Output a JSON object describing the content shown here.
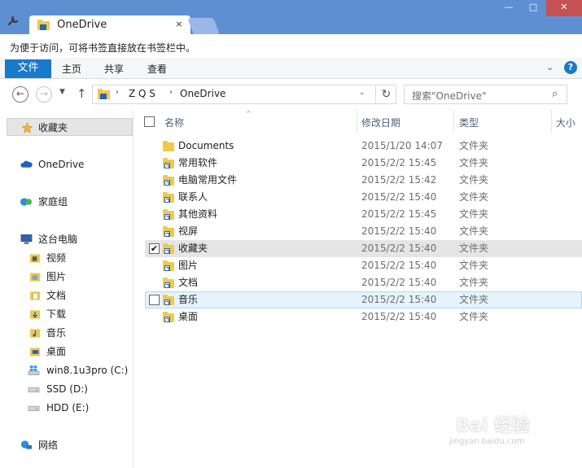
{
  "window": {
    "tab_title": "OneDrive",
    "tab_close": "×",
    "min": "—",
    "max": "□",
    "close": "✕"
  },
  "bookmark_hint": "为便于访问，可将书签直接放在书签栏中。",
  "ribbon": {
    "file": "文件",
    "tabs": [
      "主页",
      "共享",
      "查看"
    ],
    "expand": "⌄",
    "help": "?"
  },
  "nav": {
    "back": "←",
    "forward": "→",
    "recent": "▼",
    "up": "↑",
    "breadcrumb": [
      "Z Q S",
      "OneDrive"
    ],
    "separator": "›",
    "dropdown": "⌄",
    "refresh": "↻",
    "search_placeholder": "搜索\"OneDrive\"",
    "search_icon": "⌕"
  },
  "sidebar": {
    "favorites": "收藏夹",
    "onedrive": "OneDrive",
    "homegroup": "家庭组",
    "thispc": "这台电脑",
    "pc_items": [
      "视频",
      "图片",
      "文档",
      "下载",
      "音乐",
      "桌面",
      "win8.1u3pro (C:)",
      "SSD (D:)",
      "HDD (E:)"
    ],
    "network": "网络"
  },
  "columns": {
    "name": "名称",
    "date": "修改日期",
    "type": "类型",
    "size": "大小",
    "sort_indicator": "^"
  },
  "files": [
    {
      "name": "Documents",
      "date": "2015/1/20 14:07",
      "type": "文件夹"
    },
    {
      "name": "常用软件",
      "date": "2015/2/2 15:45",
      "type": "文件夹"
    },
    {
      "name": "电脑常用文件",
      "date": "2015/2/2 15:42",
      "type": "文件夹"
    },
    {
      "name": "联系人",
      "date": "2015/2/2 15:40",
      "type": "文件夹"
    },
    {
      "name": "其他资料",
      "date": "2015/2/2 15:45",
      "type": "文件夹"
    },
    {
      "name": "视屏",
      "date": "2015/2/2 15:40",
      "type": "文件夹"
    },
    {
      "name": "收藏夹",
      "date": "2015/2/2 15:40",
      "type": "文件夹"
    },
    {
      "name": "图片",
      "date": "2015/2/2 15:40",
      "type": "文件夹"
    },
    {
      "name": "文档",
      "date": "2015/2/2 15:40",
      "type": "文件夹"
    },
    {
      "name": "音乐",
      "date": "2015/2/2 15:40",
      "type": "文件夹"
    },
    {
      "name": "桌面",
      "date": "2015/2/2 15:40",
      "type": "文件夹"
    }
  ],
  "checked_mark": "✔",
  "watermark": {
    "logo": "Bai 经验",
    "url": "jingyan.baidu.com"
  }
}
